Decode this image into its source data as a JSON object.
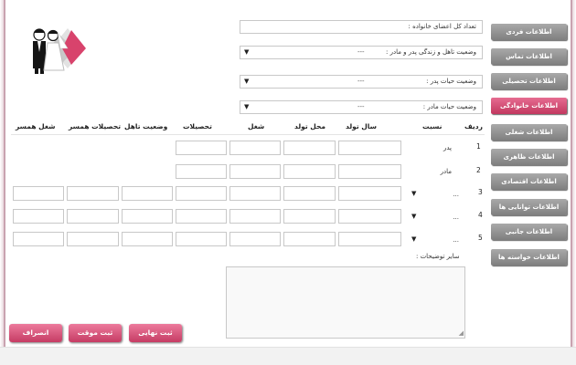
{
  "menu": {
    "items": [
      {
        "label": "اطلاعات فردی"
      },
      {
        "label": "اطلاعات تماس"
      },
      {
        "label": "اطلاعات تحصیلی"
      },
      {
        "label": "اطلاعات خانوادگی"
      },
      {
        "label": "اطلاعات شغلی"
      },
      {
        "label": "اطلاعات ظاهری"
      },
      {
        "label": "اطلاعات اقتصادی"
      },
      {
        "label": "اطلاعات توانایی ها"
      },
      {
        "label": "اطلاعات جانبی"
      },
      {
        "label": "اطلاعات خواسته ها"
      }
    ],
    "active_index": 3,
    "colors": {
      "active": "#d14a72",
      "inactive": "#8e8e8e"
    }
  },
  "family_fields": {
    "total_members": {
      "label": "تعداد کل اعضای خانواده :"
    },
    "parents_marital": {
      "label": "وضعیت تاهل و زندگی پدر و مادر :",
      "value": "---"
    },
    "father_life": {
      "label": "وضعیت حیات پدر :",
      "value": "---"
    },
    "mother_life": {
      "label": "وضعیت حیات مادر :",
      "value": "---"
    }
  },
  "table": {
    "headers": {
      "row": "ردیف",
      "relation": "نسبت",
      "birth_year": "سال تولد",
      "birth_place": "محل تولد",
      "job": "شغل",
      "education": "تحصیلات",
      "marital": "وضعیت تاهل",
      "spouse_education": "تحصیلات همسر",
      "spouse_job": "شغل همسر"
    },
    "rows": [
      {
        "num": "1",
        "relation": "پدر"
      },
      {
        "num": "2",
        "relation": "مادر"
      },
      {
        "num": "3",
        "relation": "..."
      },
      {
        "num": "4",
        "relation": "..."
      },
      {
        "num": "5",
        "relation": "..."
      }
    ]
  },
  "notes": {
    "label": "سایر توضیحات :"
  },
  "actions": {
    "final_submit": "ثبت نهایی",
    "temp_submit": "ثبت موقت",
    "cancel": "انصراف"
  },
  "icons": {
    "logo": "bride-groom-icon",
    "dropdown": "triangle-down-icon"
  },
  "accent_color": "#d14a72"
}
